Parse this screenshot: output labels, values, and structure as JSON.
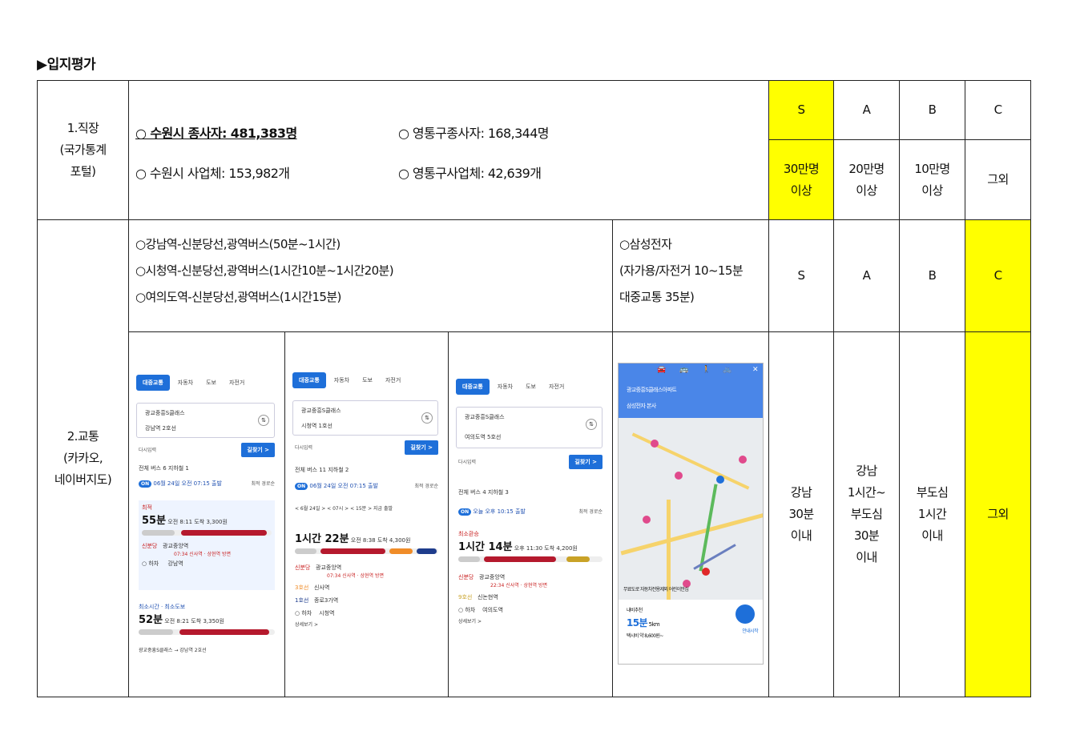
{
  "heading": "▶입지평가",
  "grades": [
    "S",
    "A",
    "B",
    "C"
  ],
  "row1": {
    "label": "1.직장\n(국가통계\n포털)",
    "items": [
      "○ 수원시 종사자: 481,383명",
      "○ 영통구종사자: 168,344명",
      "○ 수원시 사업체: 153,982개",
      "○ 영통구사업체: 42,639개"
    ],
    "criteria": [
      "30만명\n이상",
      "20만명\n이상",
      "10만명\n이상",
      "그외"
    ]
  },
  "row2": {
    "label": "2.교통\n(카카오,\n네이버지도)",
    "routes": [
      "○강남역-신분당선,광역버스(50분~1시간)",
      "○시청역-신분당선,광역버스(1시간10분~1시간20분)",
      "○여의도역-신분당선,광역버스(1시간15분)"
    ],
    "samsung": [
      "○삼성전자",
      "(자가용/자전거 10~15분",
      "대중교통 35분)"
    ],
    "criteria": [
      "강남\n30분\n이내",
      "강남\n1시간~\n부도심\n30분\n이내",
      "부도심\n1시간\n이내",
      "그외"
    ]
  },
  "highlights": {
    "yellow": "#ffff00",
    "accent": "#1e6fd9"
  },
  "app": {
    "tabs": [
      "대중교통",
      "자동차",
      "도보",
      "자전거"
    ],
    "origin": "광교중흥S클래스",
    "redo": "다시입력",
    "find": "길찾기 >",
    "opt": "최적 경로순",
    "shots": [
      {
        "dest": "강남역 2호선",
        "subtabs": "전체   버스 6   지하철 1",
        "date": "06월 24일 오전 07:15 출발",
        "r1tag": "최적",
        "r1time": "55분",
        "r1info": "오전 8:11 도착   3,300원",
        "line": "신분당",
        "station": "광교중앙역",
        "depart": "07:34 신사역 · 상현역 방면",
        "stop": "하차",
        "stopname": "강남역",
        "r2tag": "최소시간 · 최소도보",
        "r2time": "52분",
        "r2info": "오전 8:21 도착   3,350원",
        "footer": "광교중흥S클래스 → 강남역 2호선"
      },
      {
        "dest": "시청역 1호선",
        "subtabs": "전체   버스 11   지하철 2",
        "date": "06월 24일 오전 07:15 출발",
        "filters": "< 6월 24일 >   < 07시 >   < 15분 >   지금 출발",
        "r1time": "1시간 22분",
        "r1info": "오전 8:38 도착   4,300원",
        "line": "신분당",
        "station": "광교중앙역",
        "depart": "07:34 신사역 · 상현역 방면",
        "line2": "3호선",
        "st2": "신사역",
        "line3": "1호선",
        "st3": "종로3가역",
        "stop": "하차",
        "stopname": "시청역",
        "more": "상세보기 >"
      },
      {
        "dest": "여의도역 5호선",
        "subtabs": "전체   버스 4   지하철 3",
        "date": "오늘 오후 10:15 출발",
        "r1tag": "최소환승",
        "r1time": "1시간 14분",
        "r1info": "오후 11:30 도착   4,200원",
        "line": "신분당",
        "station": "광교중앙역",
        "depart": "22:34 신사역 · 상현역 방면",
        "line2": "9호선",
        "st2": "신논현역",
        "stop": "하차",
        "stopname": "여의도역",
        "more": "상세보기 >"
      }
    ],
    "map": {
      "from": "광교중흥S클래스아파트",
      "to": "삼성전자 본사",
      "chips": "무료도로   자동차전용제외   어린이안심",
      "nav": "내비추천",
      "eta": "15분",
      "dist": "5km",
      "taxi": "택시비 약 8,600원~",
      "start": "안내시작"
    }
  }
}
